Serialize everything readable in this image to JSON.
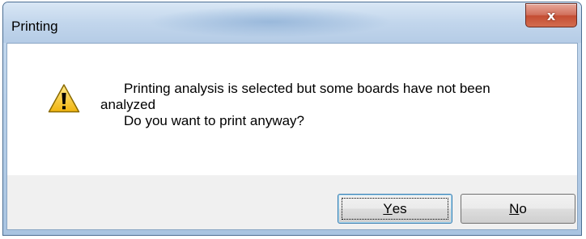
{
  "window": {
    "title": "Printing",
    "close_glyph": "x"
  },
  "message": {
    "line1": "Printing analysis is selected but some boards have not been",
    "line2": "analyzed",
    "line3": "Do you want to print anyway?"
  },
  "icon": "warning-icon",
  "buttons": {
    "yes": {
      "mnemonic": "Y",
      "rest": "es"
    },
    "no": {
      "mnemonic": "N",
      "rest": "o"
    }
  },
  "colors": {
    "titlebar": "#b7cfe8",
    "close_button": "#c44d33",
    "warning_fill": "#f5c425",
    "footer": "#f0f0f0"
  }
}
